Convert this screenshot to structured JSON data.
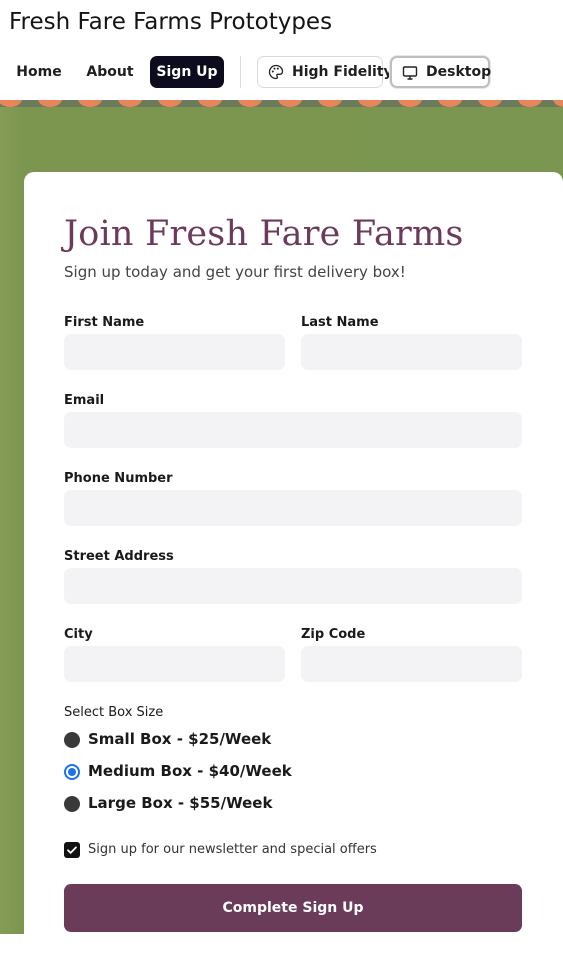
{
  "app": {
    "title": "Fresh Fare Farms Prototypes"
  },
  "nav": {
    "items": [
      {
        "label": "Home"
      },
      {
        "label": "About"
      },
      {
        "label": "Sign Up"
      }
    ],
    "fidelity_label": "High Fidelity",
    "device_label": "Desktop"
  },
  "form": {
    "title": "Join Fresh Fare Farms",
    "subtitle": "Sign up today and get your first delivery box!",
    "fields": {
      "first_name": {
        "label": "First Name",
        "value": ""
      },
      "last_name": {
        "label": "Last Name",
        "value": ""
      },
      "email": {
        "label": "Email",
        "value": ""
      },
      "phone": {
        "label": "Phone Number",
        "value": ""
      },
      "street": {
        "label": "Street Address",
        "value": ""
      },
      "city": {
        "label": "City",
        "value": ""
      },
      "zip": {
        "label": "Zip Code",
        "value": ""
      }
    },
    "box_size": {
      "label": "Select Box Size",
      "options": [
        {
          "label": "Small Box - $25/Week",
          "selected": false
        },
        {
          "label": "Medium Box - $40/Week",
          "selected": true
        },
        {
          "label": "Large Box - $55/Week",
          "selected": false
        }
      ]
    },
    "newsletter": {
      "label": "Sign up for our newsletter and special offers",
      "checked": true
    },
    "submit_label": "Complete Sign Up"
  },
  "colors": {
    "accent": "#6b3b5a",
    "nav_active": "#0d0b1e",
    "background": "#7b9650",
    "border_dots": "#e8855b",
    "radio_selected": "#1a73e8"
  },
  "icons": {
    "fidelity": "palette-icon",
    "device": "monitor-icon",
    "checkbox": "check-icon"
  }
}
